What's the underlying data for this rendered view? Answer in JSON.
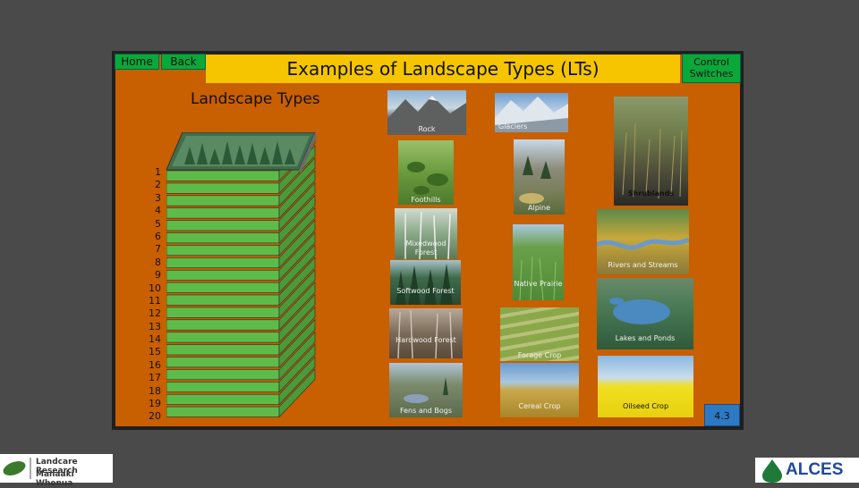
{
  "nav": {
    "home_label": "Home",
    "back_label": "Back",
    "control_label": "Control Switches"
  },
  "title": "Examples of Landscape Types (LTs)",
  "section_label": "Landscape Types",
  "layer_numbers": [
    "1",
    "2",
    "3",
    "4",
    "5",
    "6",
    "7",
    "8",
    "9",
    "10",
    "11",
    "12",
    "13",
    "14",
    "15",
    "16",
    "17",
    "18",
    "19",
    "20"
  ],
  "landscape_images": [
    {
      "label": "Rock",
      "icon": "mountain-photo"
    },
    {
      "label": "Glaciers",
      "icon": "glacier-photo"
    },
    {
      "label": "Shrublands",
      "icon": "shrubland-photo"
    },
    {
      "label": "Foothills",
      "icon": "foothills-photo"
    },
    {
      "label": "Alpine",
      "icon": "alpine-photo"
    },
    {
      "label": "Mixedwood Forest",
      "icon": "mixedwood-photo"
    },
    {
      "label": "Rivers and Streams",
      "icon": "river-photo"
    },
    {
      "label": "Softwood Forest",
      "icon": "softwood-photo"
    },
    {
      "label": "Native Prairie",
      "icon": "prairie-photo"
    },
    {
      "label": "Lakes and Ponds",
      "icon": "lake-photo"
    },
    {
      "label": "Hardwood Forest",
      "icon": "hardwood-photo"
    },
    {
      "label": "Forage Crop",
      "icon": "forage-photo"
    },
    {
      "label": "Fens and Bogs",
      "icon": "fen-photo"
    },
    {
      "label": "Cereal Crop",
      "icon": "cereal-photo"
    },
    {
      "label": "Oilseed Crop",
      "icon": "oilseed-photo"
    }
  ],
  "page_number": "4.3",
  "logos": {
    "left_line1": "Landcare Research",
    "left_line2": "Manaaki Whenua",
    "right": "ALCES"
  },
  "colors": {
    "panel": "#c85f00",
    "title_bar": "#f6c500",
    "nav_button": "#0aa83a",
    "layer_fill": "#5dbb4a",
    "page_badge": "#2e78c4"
  }
}
